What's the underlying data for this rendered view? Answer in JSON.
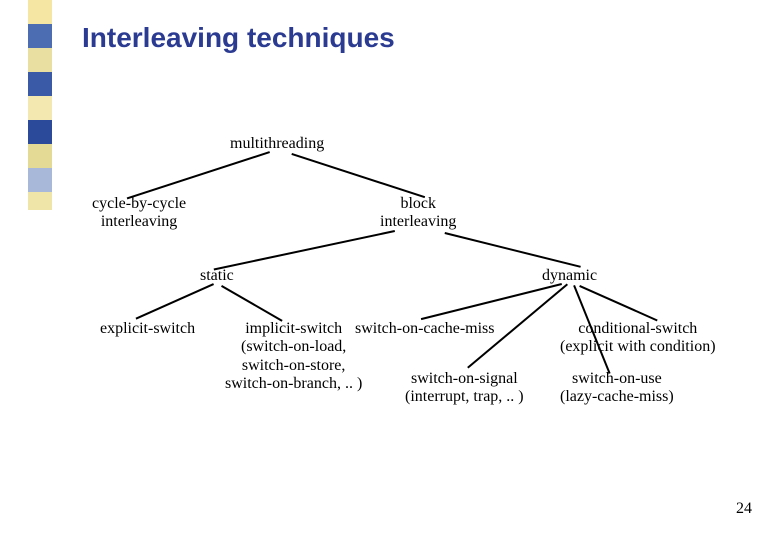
{
  "title": "Interleaving techniques",
  "nodes": {
    "root": "multithreading",
    "cbc_l1": "cycle-by-cycle",
    "cbc_l2": "interleaving",
    "blk_l1": "block",
    "blk_l2": "interleaving",
    "static": "static",
    "dynamic": "dynamic",
    "explicit": "explicit-switch",
    "implicit_l1": "implicit-switch",
    "implicit_l2": "(switch-on-load,",
    "implicit_l3": "switch-on-store,",
    "implicit_l4": "switch-on-branch, .. )",
    "cachemiss": "switch-on-cache-miss",
    "cond_l1": "conditional-switch",
    "cond_l2": "(explicit with condition)",
    "signal_l1": "switch-on-signal",
    "signal_l2": "(interrupt, trap, .. )",
    "use_l1": "switch-on-use",
    "use_l2": "(lazy-cache-miss)",
    "page": "24"
  },
  "colors": {
    "title": "#2b3b92",
    "sidebar": [
      "#f5e6a3",
      "#4d6db3",
      "#e8dfa0",
      "#3a5aa8",
      "#f2e8b0",
      "#2b4a9a",
      "#e4da95",
      "#a8b8d8",
      "#f0e5a8"
    ]
  }
}
